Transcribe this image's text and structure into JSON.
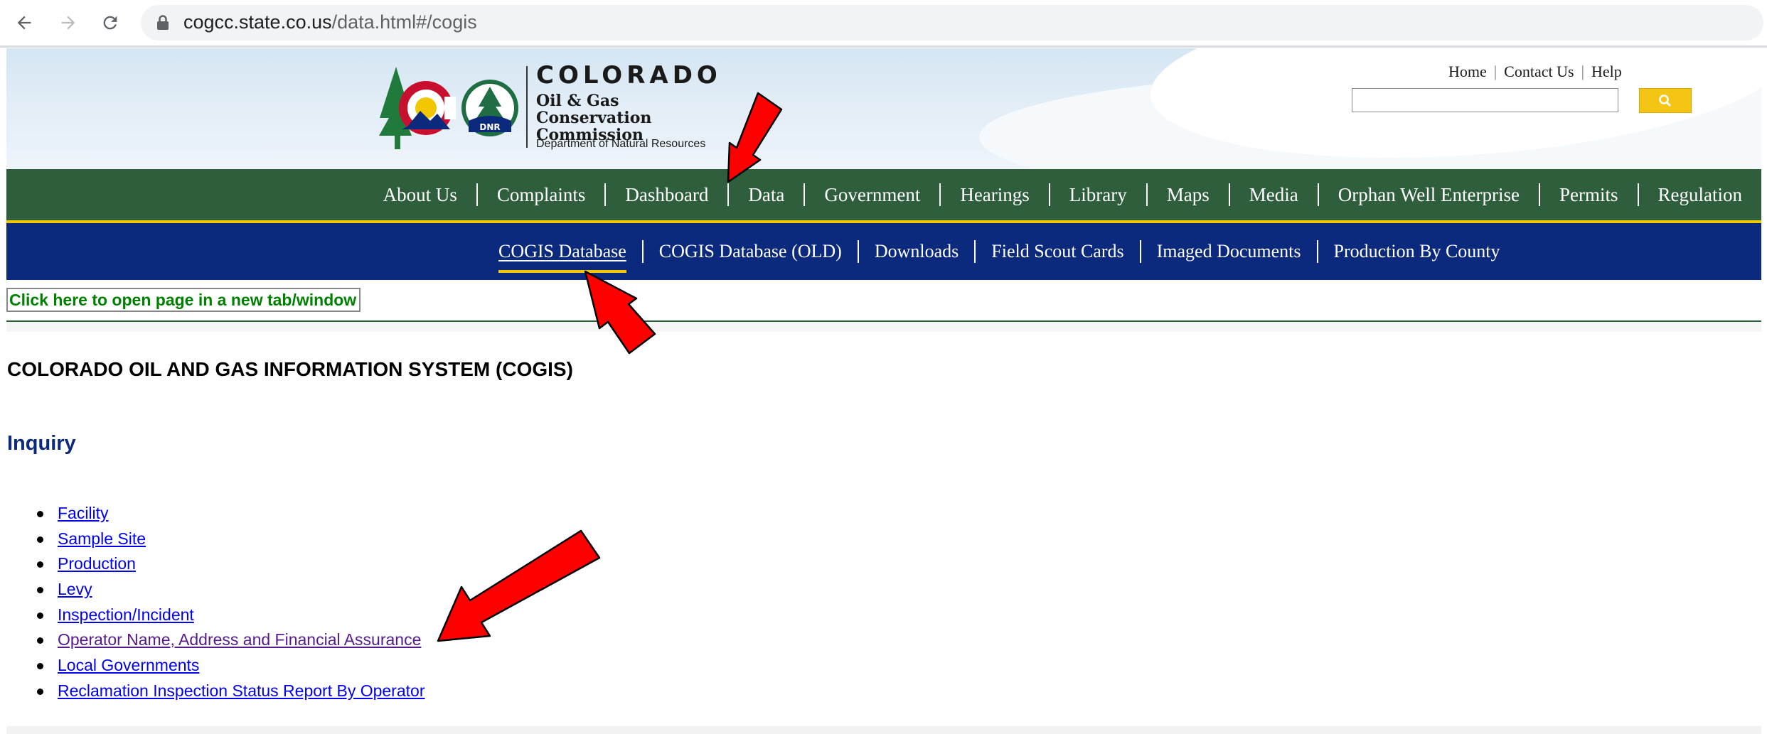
{
  "browser": {
    "url_domain": "cogcc.state.co.us",
    "url_path": "/data.html#/cogis"
  },
  "header": {
    "brand_title": "COLORADO",
    "brand_sub": "Oil & Gas Conservation Commission",
    "brand_dept": "Department of Natural Resources",
    "dnr_badge": "DNR",
    "util_links": [
      "Home",
      "Contact Us",
      "Help"
    ],
    "search_placeholder": ""
  },
  "main_nav": {
    "items": [
      "About Us",
      "Complaints",
      "Dashboard",
      "Data",
      "Government",
      "Hearings",
      "Library",
      "Maps",
      "Media",
      "Orphan Well Enterprise",
      "Permits",
      "Regulation"
    ],
    "active": "Data"
  },
  "sub_nav": {
    "items": [
      "COGIS Database",
      "COGIS Database (OLD)",
      "Downloads",
      "Field Scout Cards",
      "Imaged Documents",
      "Production By County"
    ],
    "active": "COGIS Database"
  },
  "content": {
    "new_tab_link": "Click here to open page in a new tab/window",
    "page_heading": "COLORADO OIL AND GAS INFORMATION SYSTEM (COGIS)",
    "section_heading": "Inquiry",
    "links": [
      {
        "label": "Facility",
        "visited": false
      },
      {
        "label": "Sample Site",
        "visited": false
      },
      {
        "label": "Production",
        "visited": false
      },
      {
        "label": "Levy",
        "visited": false
      },
      {
        "label": "Inspection/Incident",
        "visited": false
      },
      {
        "label": "Operator Name, Address and Financial Assurance",
        "visited": true
      },
      {
        "label": "Local Governments",
        "visited": false
      },
      {
        "label": "Reclamation Inspection Status Report By Operator",
        "visited": false
      }
    ]
  },
  "colors": {
    "nav_green": "#2e5e3b",
    "nav_blue": "#0b2a7d",
    "accent_gold": "#f2c700",
    "annotation_red": "#ff0000"
  }
}
